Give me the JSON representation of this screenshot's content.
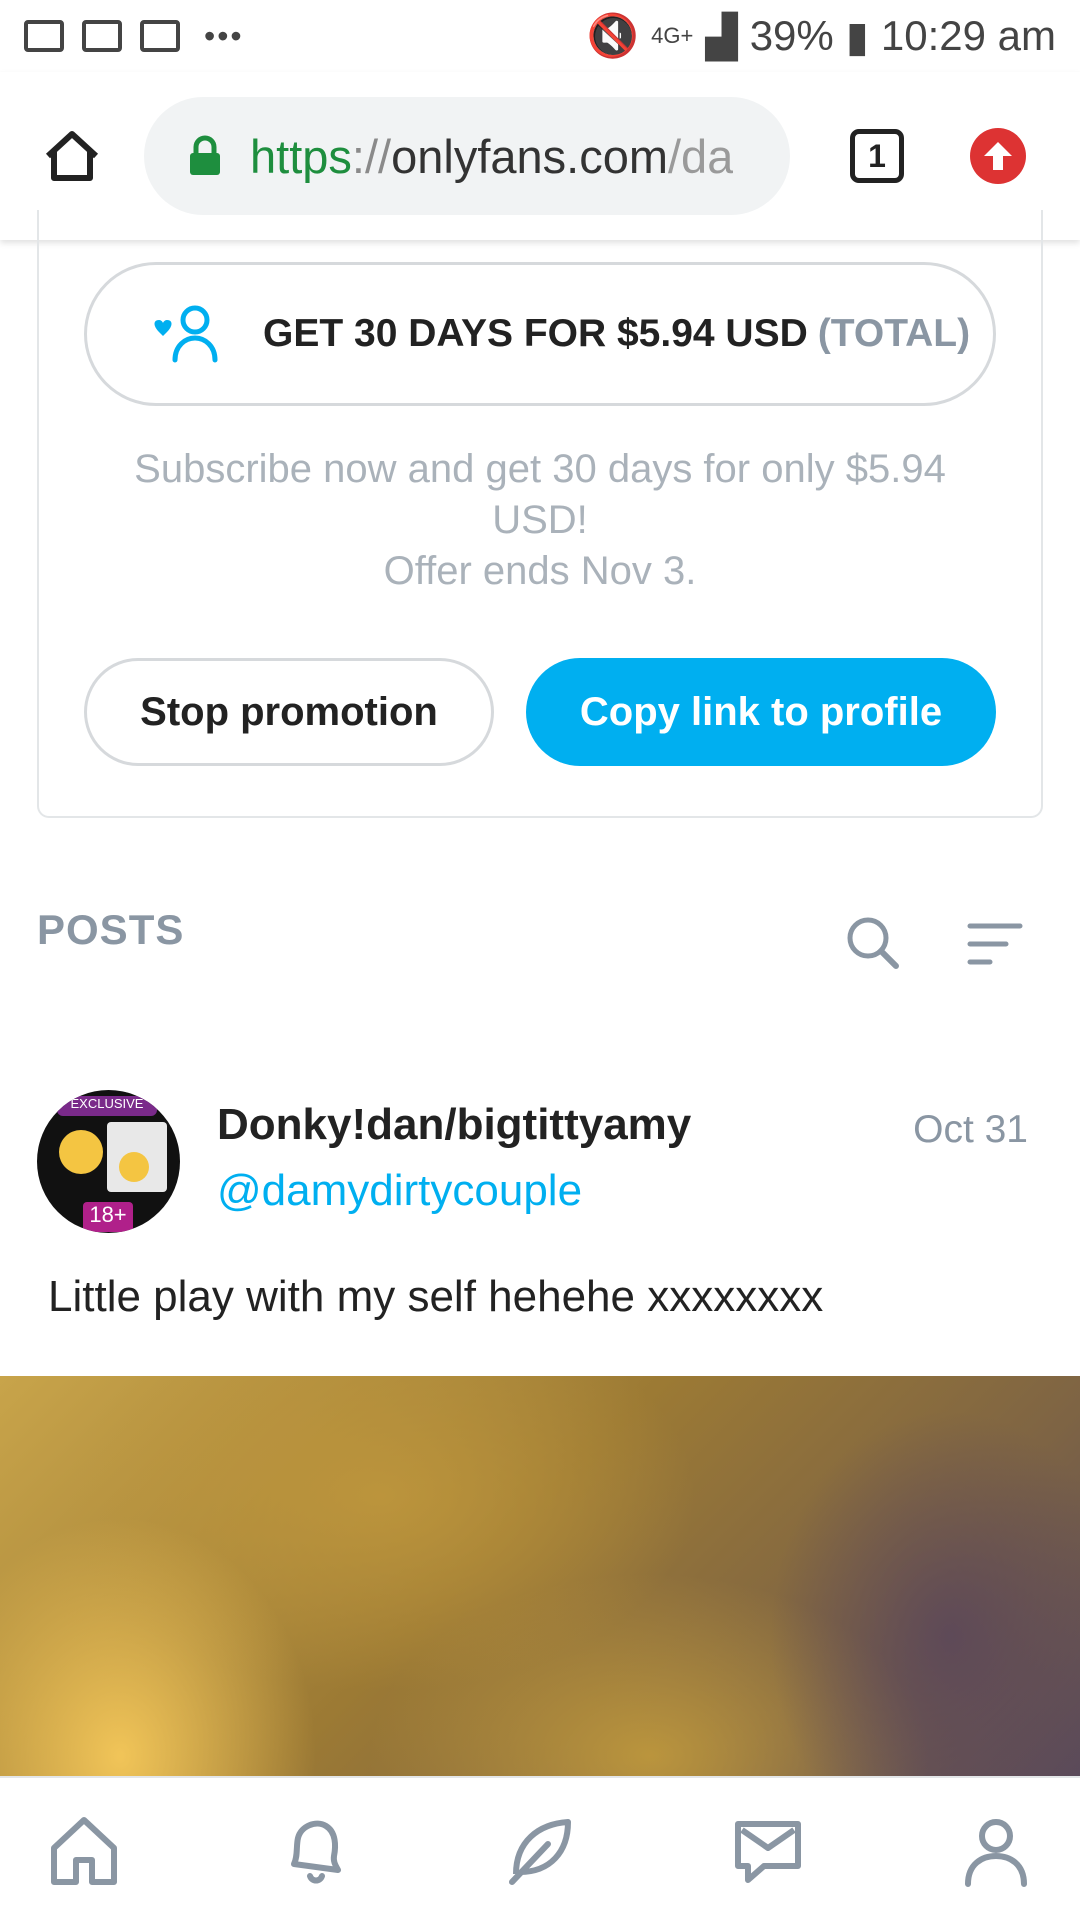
{
  "status_bar": {
    "battery": "39%",
    "time": "10:29 am",
    "network": "4G+"
  },
  "browser": {
    "url_scheme": "https",
    "url_separator": "://",
    "url_host": "onlyfans.com",
    "url_path": "/da",
    "tab_count": "1",
    "colors": {
      "secure": "#1e8e3e",
      "update": "#dd3333"
    }
  },
  "promo": {
    "subscribe_label": "GET 30 DAYS FOR $5.94 USD",
    "subscribe_total": "(TOTAL)",
    "desc_line1": "Subscribe now and get 30 days for only $5.94 USD!",
    "desc_line2": "Offer ends Nov 3.",
    "stop_label": "Stop promotion",
    "copy_label": "Copy link to profile",
    "colors": {
      "accent": "#00aff0",
      "muted": "#8a96a3"
    }
  },
  "posts": {
    "header": "POSTS"
  },
  "post": {
    "name": "Donky!dan/bigtittyamy",
    "handle": "@damydirtycouple",
    "date": "Oct 31",
    "text": "Little play with my self hehehe xxxxxxxx",
    "avatar_badge_top": "EXCLUSIVE",
    "avatar_badge_bottom": "18+"
  },
  "bottom_nav": {
    "icons": [
      "home-icon",
      "bell-icon",
      "feather-icon",
      "message-icon",
      "profile-icon"
    ]
  }
}
